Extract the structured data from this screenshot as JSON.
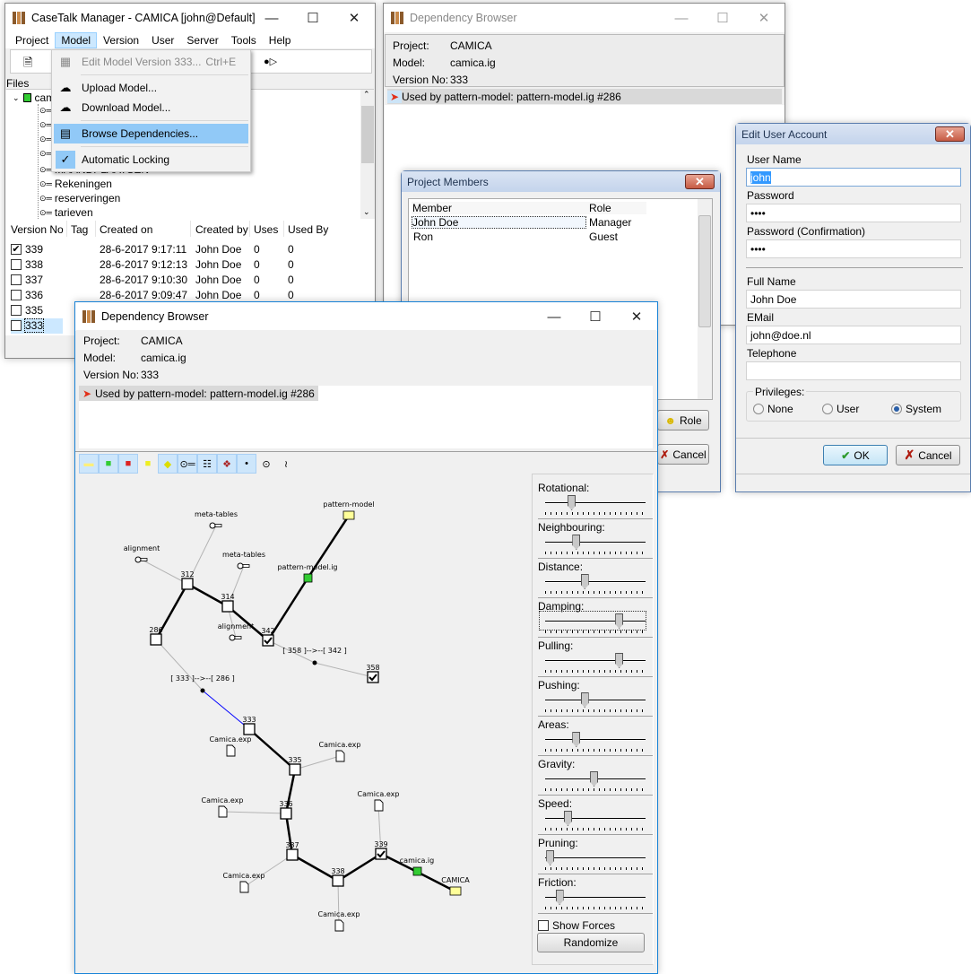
{
  "main_window": {
    "title": "CaseTalk Manager - CAMICA [john@Default]",
    "menu": [
      "Project",
      "Model",
      "Version",
      "User",
      "Server",
      "Tools",
      "Help"
    ],
    "active_menu": "Model",
    "model_menu": [
      {
        "label": "Edit Model Version 333...",
        "shortcut": "Ctrl+E",
        "icon": "grid-icon",
        "disabled": true
      },
      {
        "label": "Upload Model...",
        "icon": "cloud-upload-icon"
      },
      {
        "label": "Download Model...",
        "icon": "cloud-download-icon"
      },
      {
        "label": "Browse Dependencies...",
        "icon": "dependencies-icon",
        "highlighted": true
      },
      {
        "label": "Automatic Locking",
        "icon": "check-icon",
        "checked": true
      }
    ],
    "files_label": "Files",
    "tree": {
      "root": "camica.ig",
      "items": [
        "",
        "",
        "",
        "",
        "MAANDPLAATSEN",
        "Rekeningen",
        "reserveringen",
        "tarieven"
      ]
    },
    "versions": {
      "columns": [
        "Version No",
        "Tag",
        "Created on",
        "Created by",
        "Uses",
        "Used By"
      ],
      "rows": [
        {
          "no": "339",
          "tag": "",
          "created": "28-6-2017 9:17:11",
          "by": "John Doe",
          "uses": "0",
          "used_by": "0",
          "checked": true
        },
        {
          "no": "338",
          "tag": "",
          "created": "28-6-2017 9:12:13",
          "by": "John Doe",
          "uses": "0",
          "used_by": "0",
          "checked": false
        },
        {
          "no": "337",
          "tag": "",
          "created": "28-6-2017 9:10:30",
          "by": "John Doe",
          "uses": "0",
          "used_by": "0",
          "checked": false
        },
        {
          "no": "336",
          "tag": "",
          "created": "28-6-2017 9:09:47",
          "by": "John Doe",
          "uses": "0",
          "used_by": "0",
          "checked": false
        },
        {
          "no": "335",
          "checked": false
        },
        {
          "no": "333",
          "checked": false,
          "selected": true
        }
      ]
    }
  },
  "dep_browser_back": {
    "title": "Dependency Browser",
    "project_label": "Project:",
    "project": "CAMICA",
    "model_label": "Model:",
    "model": "camica.ig",
    "version_label": "Version No:",
    "version": "333",
    "used_by": "Used by pattern-model: pattern-model.ig #286"
  },
  "project_members": {
    "title": "Project Members",
    "columns": [
      "Member",
      "Role"
    ],
    "rows": [
      {
        "member": "John Doe",
        "role": "Manager"
      },
      {
        "member": "Ron",
        "role": "Guest"
      }
    ],
    "role_button": "Role",
    "cancel_button": "Cancel"
  },
  "edit_user": {
    "title": "Edit User Account",
    "user_name_label": "User Name",
    "user_name": "john",
    "password_label": "Password",
    "password": "••••",
    "password_confirm_label": "Password (Confirmation)",
    "password_confirm": "••••",
    "full_name_label": "Full Name",
    "full_name": "John Doe",
    "email_label": "EMail",
    "email": "john@doe.nl",
    "telephone_label": "Telephone",
    "telephone": "",
    "privileges_label": "Privileges:",
    "privileges": [
      "None",
      "User",
      "System"
    ],
    "privilege_selected": "System",
    "ok_button": "OK",
    "cancel_button": "Cancel"
  },
  "dep_browser_front": {
    "title": "Dependency Browser",
    "project_label": "Project:",
    "project": "CAMICA",
    "model_label": "Model:",
    "model": "camica.ig",
    "version_label": "Version No:",
    "version": "333",
    "used_by": "Used by pattern-model: pattern-model.ig #286",
    "toolbar": [
      {
        "icon": "folder-icon",
        "on": true
      },
      {
        "icon": "green-model-icon",
        "on": true
      },
      {
        "icon": "red-model-icon",
        "on": true
      },
      {
        "icon": "yellow-model-icon",
        "on": false
      },
      {
        "icon": "tag-icon",
        "on": true
      },
      {
        "icon": "key-icon",
        "on": true
      },
      {
        "icon": "document-icon",
        "on": true
      },
      {
        "icon": "palette-icon",
        "on": true
      },
      {
        "icon": "dot-icon",
        "on": true
      },
      {
        "icon": "link-icon",
        "on": false
      },
      {
        "icon": "chain-icon",
        "on": false
      }
    ],
    "graph": {
      "nodes": [
        {
          "id": "pm",
          "label": "pattern-model",
          "type": "folder"
        },
        {
          "id": "pmig",
          "label": "pattern-model.ig",
          "type": "model-green"
        },
        {
          "id": "mt1",
          "label": "meta-tables",
          "type": "key"
        },
        {
          "id": "al1",
          "label": "alignment",
          "type": "key"
        },
        {
          "id": "mt2",
          "label": "meta-tables",
          "type": "key"
        },
        {
          "id": "al2",
          "label": "alignment",
          "type": "key"
        },
        {
          "id": "v312",
          "label": "312",
          "type": "version"
        },
        {
          "id": "v314",
          "label": "314",
          "type": "version"
        },
        {
          "id": "v286",
          "label": "286",
          "type": "version"
        },
        {
          "id": "v342",
          "label": "342",
          "type": "version-checked"
        },
        {
          "id": "v358",
          "label": "358",
          "type": "version-checked"
        },
        {
          "id": "d1",
          "label": "[ 358 ]-->--[ 342 ]",
          "type": "dependency"
        },
        {
          "id": "d2",
          "label": "[ 333 ]-->--[ 286 ]",
          "type": "dependency"
        },
        {
          "id": "v333",
          "label": "333",
          "type": "version"
        },
        {
          "id": "v335",
          "label": "335",
          "type": "version"
        },
        {
          "id": "v336",
          "label": "336",
          "type": "version"
        },
        {
          "id": "v337",
          "label": "337",
          "type": "version"
        },
        {
          "id": "v338",
          "label": "338",
          "type": "version"
        },
        {
          "id": "v339",
          "label": "339",
          "type": "version-checked"
        },
        {
          "id": "e1",
          "label": "Camica.exp",
          "type": "document"
        },
        {
          "id": "e2",
          "label": "Camica.exp",
          "type": "document"
        },
        {
          "id": "e3",
          "label": "Camica.exp",
          "type": "document"
        },
        {
          "id": "e4",
          "label": "Camica.exp",
          "type": "document"
        },
        {
          "id": "e5",
          "label": "Camica.exp",
          "type": "document"
        },
        {
          "id": "e6",
          "label": "Camica.exp",
          "type": "document"
        },
        {
          "id": "cig",
          "label": "camica.ig",
          "type": "model-green"
        },
        {
          "id": "cam",
          "label": "CAMICA",
          "type": "folder"
        }
      ],
      "edges": [
        [
          "pm",
          "pmig",
          "strong"
        ],
        [
          "pmig",
          "v342",
          "strong"
        ],
        [
          "v342",
          "v314",
          "strong"
        ],
        [
          "v314",
          "v312",
          "strong"
        ],
        [
          "v312",
          "v286",
          "strong"
        ],
        [
          "mt1",
          "v312",
          "weak"
        ],
        [
          "al1",
          "v312",
          "weak"
        ],
        [
          "mt2",
          "v314",
          "weak"
        ],
        [
          "al2",
          "v314",
          "weak"
        ],
        [
          "v342",
          "d1",
          "weak"
        ],
        [
          "d1",
          "v358",
          "weak"
        ],
        [
          "v286",
          "d2",
          "weak"
        ],
        [
          "d2",
          "v333",
          "dependency"
        ],
        [
          "v333",
          "v335",
          "strong"
        ],
        [
          "v335",
          "v336",
          "strong"
        ],
        [
          "v336",
          "v337",
          "strong"
        ],
        [
          "v337",
          "v338",
          "strong"
        ],
        [
          "v338",
          "v339",
          "strong"
        ],
        [
          "v339",
          "cig",
          "strong"
        ],
        [
          "cig",
          "cam",
          "strong"
        ],
        [
          "v335",
          "e2",
          "weak"
        ],
        [
          "v336",
          "e3",
          "weak"
        ],
        [
          "v337",
          "e4",
          "weak"
        ],
        [
          "v338",
          "e5",
          "weak"
        ],
        [
          "v339",
          "e6",
          "weak"
        ]
      ],
      "colors": {
        "strong": "#000000",
        "weak": "#b4b4b4",
        "dependency": "#0000ff",
        "folder": "#ffff99",
        "model-green": "#33cc33"
      }
    },
    "sliders": [
      {
        "label": "Rotational:",
        "value": 0.28
      },
      {
        "label": "Neighbouring:",
        "value": 0.33
      },
      {
        "label": "Distance:",
        "value": 0.42
      },
      {
        "label": "Damping:",
        "value": 0.79,
        "focused": true
      },
      {
        "label": "Pulling:",
        "value": 0.79
      },
      {
        "label": "Pushing:",
        "value": 0.42
      },
      {
        "label": "Areas:",
        "value": 0.33
      },
      {
        "label": "Gravity:",
        "value": 0.52
      },
      {
        "label": "Speed:",
        "value": 0.24
      },
      {
        "label": "Pruning:",
        "value": 0.05
      },
      {
        "label": "Friction:",
        "value": 0.15
      }
    ],
    "show_forces_label": "Show Forces",
    "show_forces": false,
    "randomize_button": "Randomize"
  }
}
